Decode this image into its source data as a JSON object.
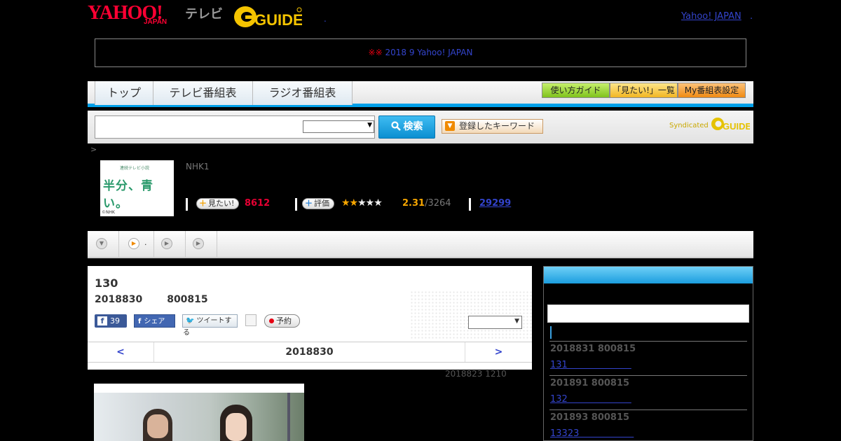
{
  "header": {
    "logo_yahoo": "YAHOO!",
    "logo_japan": "JAPAN",
    "logo_tv": "テレビ",
    "logo_gguide": "GUIDE",
    "dot_link": ".",
    "yahoo_japan_link": "Yahoo! JAPAN",
    "yahoo_japan_dot": "."
  },
  "notice": {
    "mark": "※※",
    "link_text": "2018 9 Yahoo! JAPAN",
    "link_tail": "　　　　　"
  },
  "nav": {
    "tabs": [
      "トップ",
      "テレビ番組表",
      "ラジオ番組表"
    ],
    "guide_buttons": [
      "使い方ガイド",
      "「見たい!」一覧",
      "My番組表設定"
    ]
  },
  "search": {
    "query": "",
    "select_value": "",
    "button_label": "検索",
    "keyword_button": "登録したキーワード",
    "syndicated": "Syndicated"
  },
  "breadcrumb": ">",
  "program": {
    "thumb_title": "半分、青い。",
    "thumb_sub": "連続テレビ小説",
    "thumb_copyright": "©NHK",
    "channel": "NHK1",
    "mitai_label": "見たい!",
    "mitai_count": "8612",
    "rating_label": "評価",
    "stars_filled": "★★",
    "stars_empty": "★★★",
    "rating_value": "2.31",
    "rating_total": "/3264",
    "review_count": "29299"
  },
  "tabs_row": {
    "tab2_text": "."
  },
  "episode": {
    "title": "130",
    "date": "2018830",
    "time": "800815",
    "fb_count": "39",
    "fb_share": "シェア",
    "tweet": "ツイートする",
    "reserve": "予約",
    "select_value": "",
    "prev": "<",
    "next": ">",
    "current_date": "2018830",
    "updated": "2018823  1210"
  },
  "sidebar": {
    "search_value": "",
    "episodes": [
      {
        "date": "2018831  800815",
        "link": "131　　　　　　　"
      },
      {
        "date": "201891  800815",
        "link": "132　　　　　　　"
      },
      {
        "date": "201893  800815",
        "link": "13323　　　　　　"
      }
    ]
  }
}
